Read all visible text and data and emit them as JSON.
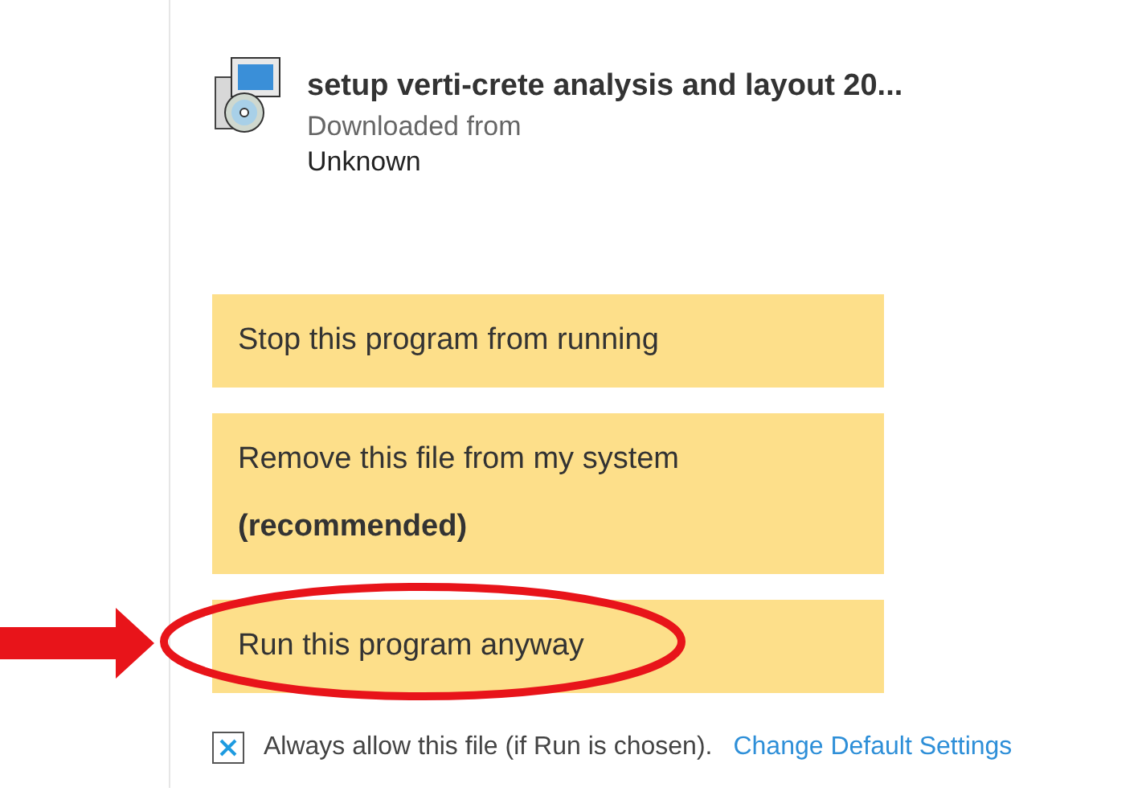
{
  "file": {
    "name": "setup verti-crete analysis and layout 20...",
    "source_label": "Downloaded from",
    "source": "Unknown"
  },
  "options": [
    {
      "label": "Stop this program from running"
    },
    {
      "label": "Remove this file from my system",
      "note": "(recommended)"
    },
    {
      "label": "Run this program anyway"
    }
  ],
  "always_allow": {
    "label": "Always allow this file (if Run is chosen).",
    "checked": true
  },
  "link": "Change Default Settings"
}
